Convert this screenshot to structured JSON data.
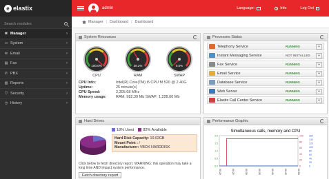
{
  "app": {
    "logo_text": "elastix",
    "logo_mark": "e"
  },
  "sidebar": {
    "search_placeholder": "Search modules",
    "items": [
      {
        "label": "Manager",
        "icon": "gear-icon",
        "active": true
      },
      {
        "label": "System",
        "icon": "monitor-icon"
      },
      {
        "label": "Email",
        "icon": "envelope-icon"
      },
      {
        "label": "Fax",
        "icon": "printer-icon"
      },
      {
        "label": "PBX",
        "icon": "phone-icon"
      },
      {
        "label": "Reports",
        "icon": "chart-icon"
      },
      {
        "label": "Security",
        "icon": "shield-icon"
      },
      {
        "label": "History",
        "icon": "clock-icon"
      }
    ]
  },
  "topbar": {
    "username": "admin",
    "language_label": "Language:",
    "info_label": "Info",
    "logout_label": "Log Out",
    "accent": "#e8272b"
  },
  "breadcrumb": {
    "items": [
      "Manager",
      "Dashboard",
      "Dashboard"
    ]
  },
  "system_resources": {
    "title": "System Resources",
    "gauges": [
      {
        "name": "CPU",
        "reading": "100.0%",
        "percent": 100
      },
      {
        "name": "RAM",
        "reading": "39.2%",
        "percent": 39.2
      },
      {
        "name": "SWAP",
        "reading": "0.0%",
        "percent": 0
      }
    ],
    "info": [
      {
        "key": "CPU Info:",
        "value": "Intel(R) Core(TM) i5 CPU M 520 @ 2.40G"
      },
      {
        "key": "Uptime:",
        "value": "25 minute(s)"
      },
      {
        "key": "CPU Speed:",
        "value": "2,305.68 MHz"
      },
      {
        "key": "Memory usage:",
        "value": "RAM: 982.39 Mb SWAP: 1,228.00 Mb"
      }
    ]
  },
  "processes": {
    "title": "Processes Status",
    "items": [
      {
        "name": "Telephony Service",
        "status": "RUNNING",
        "icon_color": "#e06a2c"
      },
      {
        "name": "Instant Messaging Service",
        "status": "NOT INSTALLED",
        "icon_color": "#4a8fd0"
      },
      {
        "name": "Fax Service",
        "status": "RUNNING",
        "icon_color": "#8a8a8a"
      },
      {
        "name": "Email Service",
        "status": "RUNNING",
        "icon_color": "#e0b030"
      },
      {
        "name": "Database Service",
        "status": "RUNNING",
        "icon_color": "#7a9bc4"
      },
      {
        "name": "Web Server",
        "status": "RUNNING",
        "icon_color": "#3e7ab8"
      },
      {
        "name": "Elastix Call Center Service",
        "status": "RUNNING",
        "icon_color": "#d04040"
      }
    ]
  },
  "hard_drives": {
    "title": "Hard Drives",
    "used_label": "18% Used",
    "available_label": "82% Available",
    "used_percent": 18,
    "used_color": "#6d6fc7",
    "available_color": "#8a2d86",
    "capacity_label": "Hard Disk Capacity:",
    "capacity_value": "10.02GB",
    "mount_label": "Mount Point :",
    "mount_value": "/",
    "manufacturer_label": "Manufacturer:",
    "manufacturer_value": "VBOX HARDDISK",
    "note": "Click below to fetch directory report. WARNING: this operation may take a long time AND impact system performance.",
    "button_label": "Fetch directory report"
  },
  "performance": {
    "title": "Performance Graphic"
  },
  "chart_data": {
    "type": "line",
    "title": "Simultaneous calls, memory and CPU",
    "left_axis_ticks": [
      "2.0",
      "1.5",
      "1.0",
      "0.5",
      "0.0"
    ],
    "right_axis_ticks": [
      "100",
      "80",
      "60",
      "40",
      "20",
      "0"
    ],
    "right_axis_ticks_2": [
      "160",
      "140",
      "120",
      "100",
      "80",
      "60",
      "40",
      "20",
      "0"
    ],
    "x_ticks": [
      "00:20",
      "00:25",
      "00:30",
      "00:35",
      "00:40",
      "00:45",
      "00:50"
    ],
    "series": [
      {
        "color": "#2fa02f",
        "values": [
          0,
          0,
          0,
          0,
          0,
          0,
          0
        ]
      },
      {
        "color": "#cc3344",
        "values": [
          0,
          1.8,
          1.8,
          1.8,
          1.8,
          1.8,
          1.8
        ]
      },
      {
        "color": "#3b5bdb",
        "values": [
          0,
          0,
          0,
          0,
          0,
          0,
          0
        ]
      }
    ]
  }
}
